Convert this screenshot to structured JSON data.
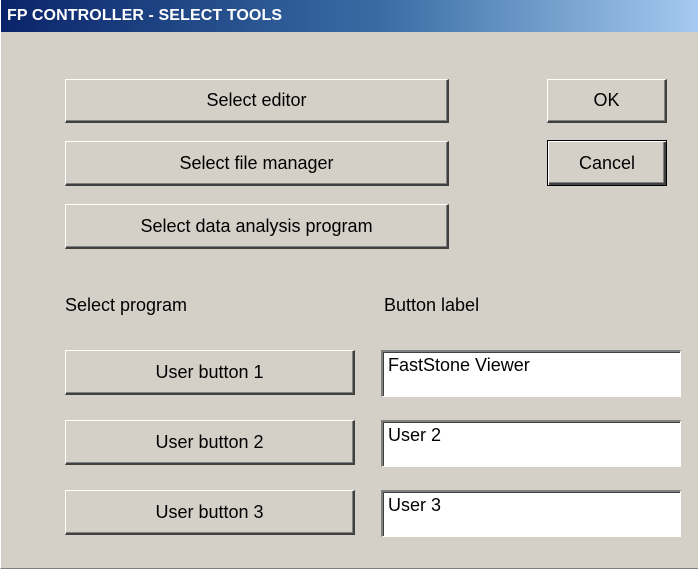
{
  "window": {
    "title": "FP CONTROLLER - SELECT TOOLS"
  },
  "tools": {
    "select_editor": "Select editor",
    "select_file_manager": "Select file manager",
    "select_data_analysis": "Select data analysis program"
  },
  "dialog": {
    "ok_label": "OK",
    "cancel_label": "Cancel"
  },
  "user_section": {
    "select_program_header": "Select program",
    "button_label_header": "Button label",
    "rows": [
      {
        "button": "User button 1",
        "label_value": "FastStone Viewer"
      },
      {
        "button": "User button 2",
        "label_value": "User 2"
      },
      {
        "button": "User button 3",
        "label_value": "User 3"
      }
    ]
  },
  "colors": {
    "dialog_bg": "#d4d0c8",
    "titlebar_start": "#0a246a",
    "titlebar_end": "#a6caf0"
  }
}
